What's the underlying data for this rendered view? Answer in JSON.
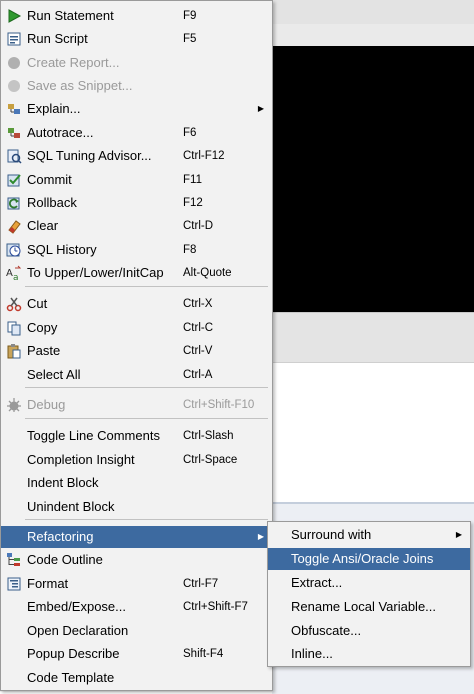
{
  "main_menu": [
    {
      "id": "run-statement",
      "label": "Run Statement",
      "shortcut": "F9",
      "icon": "run-icon"
    },
    {
      "id": "run-script",
      "label": "Run Script",
      "shortcut": "F5",
      "icon": "script-icon"
    },
    {
      "id": "create-report",
      "label": "Create Report...",
      "shortcut": "",
      "icon": "report-icon",
      "disabled": true
    },
    {
      "id": "save-snippet",
      "label": "Save as Snippet...",
      "shortcut": "",
      "icon": "snippet-icon",
      "disabled": true
    },
    {
      "id": "explain",
      "label": "Explain...",
      "shortcut": "",
      "icon": "explain-icon",
      "submenu": true
    },
    {
      "id": "autotrace",
      "label": "Autotrace...",
      "shortcut": "F6",
      "icon": "autotrace-icon"
    },
    {
      "id": "sql-tuning-advisor",
      "label": "SQL Tuning Advisor...",
      "shortcut": "Ctrl-F12",
      "icon": "tuning-icon"
    },
    {
      "id": "commit",
      "label": "Commit",
      "shortcut": "F11",
      "icon": "commit-icon"
    },
    {
      "id": "rollback",
      "label": "Rollback",
      "shortcut": "F12",
      "icon": "rollback-icon"
    },
    {
      "id": "clear",
      "label": "Clear",
      "shortcut": "Ctrl-D",
      "icon": "eraser-icon"
    },
    {
      "id": "sql-history",
      "label": "SQL History",
      "shortcut": "F8",
      "icon": "history-icon"
    },
    {
      "id": "to-upper-lower",
      "label": "To Upper/Lower/InitCap",
      "shortcut": "Alt-Quote",
      "icon": "case-icon"
    },
    {
      "id": "cut",
      "label": "Cut",
      "shortcut": "Ctrl-X",
      "icon": "scissors-icon"
    },
    {
      "id": "copy",
      "label": "Copy",
      "shortcut": "Ctrl-C",
      "icon": "copy-icon"
    },
    {
      "id": "paste",
      "label": "Paste",
      "shortcut": "Ctrl-V",
      "icon": "paste-icon"
    },
    {
      "id": "select-all",
      "label": "Select All",
      "shortcut": "Ctrl-A",
      "icon": ""
    },
    {
      "id": "debug",
      "label": "Debug",
      "shortcut": "Ctrl+Shift-F10",
      "icon": "debug-icon",
      "disabled": true
    },
    {
      "id": "toggle-line-comments",
      "label": "Toggle Line Comments",
      "shortcut": "Ctrl-Slash",
      "icon": ""
    },
    {
      "id": "completion-insight",
      "label": "Completion Insight",
      "shortcut": "Ctrl-Space",
      "icon": ""
    },
    {
      "id": "indent-block",
      "label": "Indent Block",
      "shortcut": "",
      "icon": ""
    },
    {
      "id": "unindent-block",
      "label": "Unindent Block",
      "shortcut": "",
      "icon": ""
    },
    {
      "id": "refactoring",
      "label": "Refactoring",
      "shortcut": "",
      "icon": "",
      "submenu": true,
      "selected": true
    },
    {
      "id": "code-outline",
      "label": "Code Outline",
      "shortcut": "",
      "icon": "outline-icon"
    },
    {
      "id": "format",
      "label": "Format",
      "shortcut": "Ctrl-F7",
      "icon": "format-icon"
    },
    {
      "id": "embed-expose",
      "label": "Embed/Expose...",
      "shortcut": "Ctrl+Shift-F7",
      "icon": ""
    },
    {
      "id": "open-declaration",
      "label": "Open Declaration",
      "shortcut": "",
      "icon": ""
    },
    {
      "id": "popup-describe",
      "label": "Popup Describe",
      "shortcut": "Shift-F4",
      "icon": ""
    },
    {
      "id": "code-template",
      "label": "Code Template",
      "shortcut": "",
      "icon": ""
    }
  ],
  "sub_menu": [
    {
      "id": "surround-with",
      "label": "Surround with",
      "submenu": true
    },
    {
      "id": "toggle-ansi-oracle-joins",
      "label": "Toggle Ansi/Oracle Joins",
      "selected": true
    },
    {
      "id": "extract",
      "label": "Extract..."
    },
    {
      "id": "rename-local-variable",
      "label": "Rename Local Variable..."
    },
    {
      "id": "obfuscate",
      "label": "Obfuscate..."
    },
    {
      "id": "inline",
      "label": "Inline..."
    }
  ],
  "colors": {
    "selection": "#3d6aa0",
    "menu_bg": "#f2f2f2",
    "disabled_text": "#9a9a9a"
  }
}
